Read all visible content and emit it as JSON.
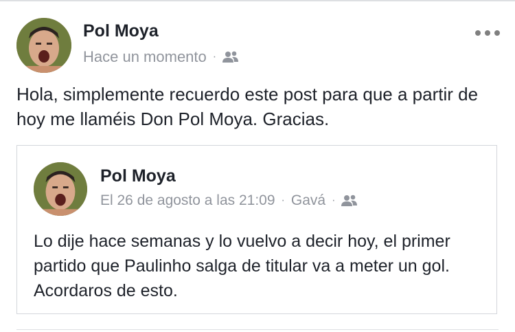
{
  "post": {
    "author": "Pol Moya",
    "time": "Hace un momento",
    "separator": "·",
    "audience_icon": "group-icon",
    "more_icon": "more-options-icon",
    "text": "Hola, simplemente recuerdo este post para que a partir de hoy me llaméis Don Pol Moya. Gracias."
  },
  "shared_post": {
    "author": "Pol Moya",
    "time": "El 26 de agosto a las 21:09",
    "separator": "·",
    "location": "Gavá",
    "separator2": "·",
    "audience_icon": "group-icon",
    "text": "Lo dije hace semanas y lo vuelvo a decir hoy, el primer partido que Paulinho salga de titular va a meter un gol. Acordaros de esto."
  },
  "colors": {
    "text": "#1d2129",
    "meta": "#90949c",
    "border": "#d3d6db"
  }
}
